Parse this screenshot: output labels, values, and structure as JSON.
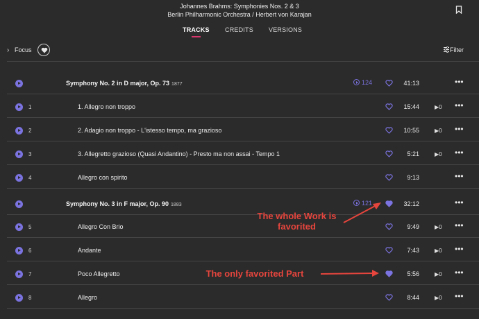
{
  "header": {
    "title": "Johannes Brahms: Symphonies Nos. 2 & 3",
    "subtitle": "Berlin Philharmonic Orchestra / Herbert von Karajan",
    "bookmark_icon": "bookmark-icon"
  },
  "tabs": [
    {
      "label": "TRACKS",
      "active": true
    },
    {
      "label": "CREDITS",
      "active": false
    },
    {
      "label": "VERSIONS",
      "active": false
    }
  ],
  "focus_bar": {
    "label": "Focus",
    "filter_label": "Filter"
  },
  "accent_color": "#7b73e0",
  "tab_underline_color": "#d9376e",
  "rows": [
    {
      "type": "work",
      "title": "Symphony No. 2 in D major, Op. 73",
      "year": "1877",
      "versions": "124",
      "favorited": false,
      "duration": "41:13"
    },
    {
      "type": "track",
      "num": "1",
      "title": "1. Allegro non troppo",
      "favorited": false,
      "duration": "15:44",
      "plays": "0"
    },
    {
      "type": "track",
      "num": "2",
      "title": "2. Adagio non troppo - L'istesso tempo, ma grazioso",
      "favorited": false,
      "duration": "10:55",
      "plays": "0"
    },
    {
      "type": "track",
      "num": "3",
      "title": "3. Allegretto grazioso (Quasi Andantino) - Presto ma non assai - Tempo 1",
      "favorited": false,
      "duration": "5:21",
      "plays": "0"
    },
    {
      "type": "track",
      "num": "4",
      "title": "Allegro con spirito",
      "favorited": false,
      "duration": "9:13",
      "plays": ""
    },
    {
      "type": "work",
      "title": "Symphony No. 3 in F major, Op. 90",
      "year": "1883",
      "versions": "121",
      "favorited": true,
      "duration": "32:12"
    },
    {
      "type": "track",
      "num": "5",
      "title": "Allegro Con Brio",
      "favorited": false,
      "duration": "9:49",
      "plays": "0"
    },
    {
      "type": "track",
      "num": "6",
      "title": "Andante",
      "favorited": false,
      "duration": "7:43",
      "plays": "0"
    },
    {
      "type": "track",
      "num": "7",
      "title": "Poco Allegretto",
      "favorited": true,
      "duration": "5:56",
      "plays": "0"
    },
    {
      "type": "track",
      "num": "8",
      "title": "Allegro",
      "favorited": false,
      "duration": "8:44",
      "plays": "0"
    }
  ],
  "annotations": {
    "work_line1": "The whole Work is",
    "work_line2": "favorited",
    "part": "The only favorited Part"
  }
}
